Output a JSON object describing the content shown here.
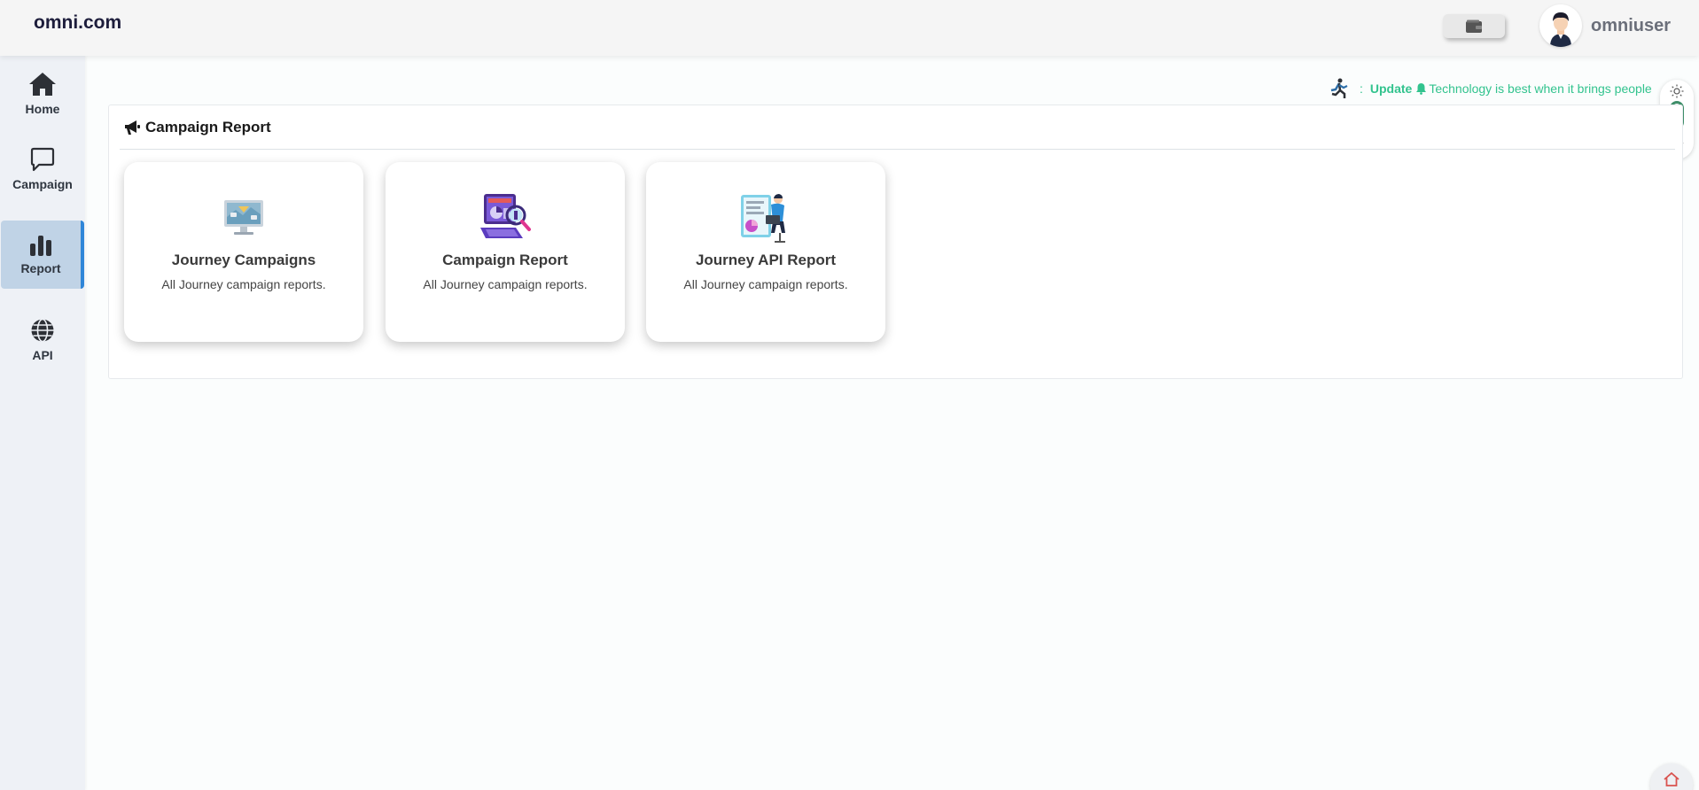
{
  "header": {
    "brand": "omni.com",
    "username": "omniuser"
  },
  "sidebar": {
    "items": [
      {
        "label": "Home",
        "icon": "home-icon"
      },
      {
        "label": "Campaign",
        "icon": "chat-bubble-icon"
      },
      {
        "label": "Report",
        "icon": "bar-chart-icon",
        "active": true
      },
      {
        "label": "API",
        "icon": "globe-icon"
      }
    ]
  },
  "ticker": {
    "prefix": ":",
    "update_label": "Update",
    "message": "Technology is best when it brings people"
  },
  "panel": {
    "title": "Campaign Report",
    "cards": [
      {
        "title": "Journey Campaigns",
        "description": "All Journey campaign reports."
      },
      {
        "title": "Campaign Report",
        "description": "All Journey campaign reports."
      },
      {
        "title": "Journey API Report",
        "description": "All Journey campaign reports."
      }
    ]
  },
  "colors": {
    "accent": "#2f86d8",
    "active_bg": "#c0d3e6",
    "ticker_green": "#32c38e",
    "toggle_green": "#3e8e69"
  }
}
